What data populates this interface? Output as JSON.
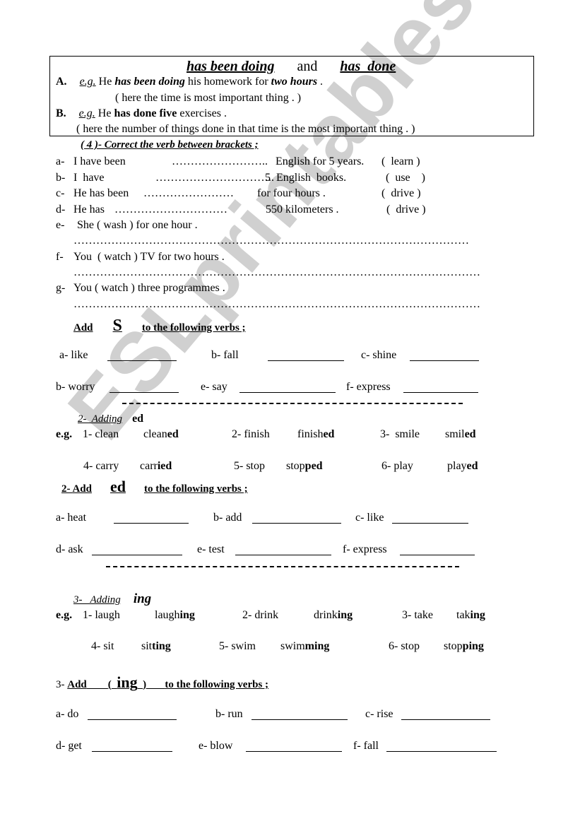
{
  "watermark": "ESLprintables.com",
  "header": {
    "title_left": "has been doing",
    "title_mid": "and",
    "title_right": "has  done",
    "a_label": "A.",
    "a_eg": "e.g.",
    "a_t1": "He",
    "a_t2": "has been doing",
    "a_t3": "his homework for",
    "a_t4": "two hours",
    "a_t5": ".",
    "a_note": "( here the time is most important thing . )",
    "b_label": "B.",
    "b_eg": "e.g.",
    "b_t1": "He",
    "b_t2": "has done five",
    "b_t3": "exercises .",
    "b_note": "( here the number of things done in that time is the most important thing . )"
  },
  "section4": {
    "title": "( 4 )- Correct the verb between brackets ;",
    "items": [
      {
        "label": "a-",
        "before": "I have been",
        "dots": "……………………..",
        "after": "English for 5 years.",
        "verb": "(  learn )"
      },
      {
        "label": "b-",
        "before": "I  have",
        "dots": "…………………………..",
        "after": "5  English  books.",
        "verb": "(  use    )"
      },
      {
        "label": "c-",
        "before": "He has been",
        "dots": "……………………",
        "after": "for four hours .",
        "verb": "(  drive )"
      },
      {
        "label": "d-",
        "before": "He has",
        "dots": "…………………………",
        "after": "550 kilometers .",
        "verb": "(  drive )"
      },
      {
        "label": "e-",
        "sentence": "She ( wash ) for one hour .",
        "answer": "……………………………………………………………………………………………"
      },
      {
        "label": "f-",
        "sentence": "You  ( watch ) TV for two hours .",
        "answer": "………………………………………………………………………………………………"
      },
      {
        "label": "g-",
        "sentence": "You ( watch ) three programmes .",
        "answer": "………………………………………………………………………………………………"
      }
    ]
  },
  "add_s": {
    "title_add": "Add",
    "title_letter": "S",
    "title_rest": "to the following verbs ;",
    "row1": [
      "a- like",
      "b- fall",
      "c- shine"
    ],
    "row2": [
      "b- worry",
      "e- say",
      "f- express"
    ]
  },
  "adding_ed": {
    "title": "2-  Adding",
    "suffix": "ed",
    "eg": "e.g.",
    "examples_row1": [
      {
        "base": "1- clean",
        "stem": "clean",
        "suf": "ed"
      },
      {
        "base": "2- finish",
        "stem": "finish",
        "suf": "ed"
      },
      {
        "base": "3-  smile",
        "stem": "smil",
        "suf": "ed"
      }
    ],
    "examples_row2": [
      {
        "base": "4- carry",
        "stem": "carr",
        "suf": "ied"
      },
      {
        "base": "5- stop",
        "stem": "stop",
        "suf": "ped"
      },
      {
        "base": "6- play",
        "stem": "play",
        "suf": "ed"
      }
    ]
  },
  "add_ed": {
    "num": "2-",
    "title_add": "Add",
    "title_suffix": "ed",
    "title_rest": "to the following verbs ;",
    "row1": [
      "a- heat",
      "b- add",
      "c- like"
    ],
    "row2": [
      "d- ask",
      "e- test",
      "f- express"
    ]
  },
  "adding_ing": {
    "title": "3-   Adding",
    "suffix": "ing",
    "eg": "e.g.",
    "examples_row1": [
      {
        "base": "1- laugh",
        "stem": "laugh",
        "suf": "ing"
      },
      {
        "base": "2- drink",
        "stem": "drink",
        "suf": "ing"
      },
      {
        "base": "3- take",
        "stem": "tak",
        "suf": "ing"
      }
    ],
    "examples_row2": [
      {
        "base": "4- sit",
        "stem": "sit",
        "suf": "ting"
      },
      {
        "base": "5- swim",
        "stem": "swim",
        "suf": "ming"
      },
      {
        "base": "6- stop",
        "stem": "stop",
        "suf": "ping"
      }
    ]
  },
  "add_ing": {
    "num": "3-",
    "title_add": "Add",
    "title_open": "(",
    "title_suffix": "ing",
    "title_close": ")",
    "title_rest": "to the following verbs ;",
    "row1": [
      "a- do",
      "b- run",
      "c- rise"
    ],
    "row2": [
      "d- get",
      "e- blow",
      "f- fall"
    ]
  }
}
